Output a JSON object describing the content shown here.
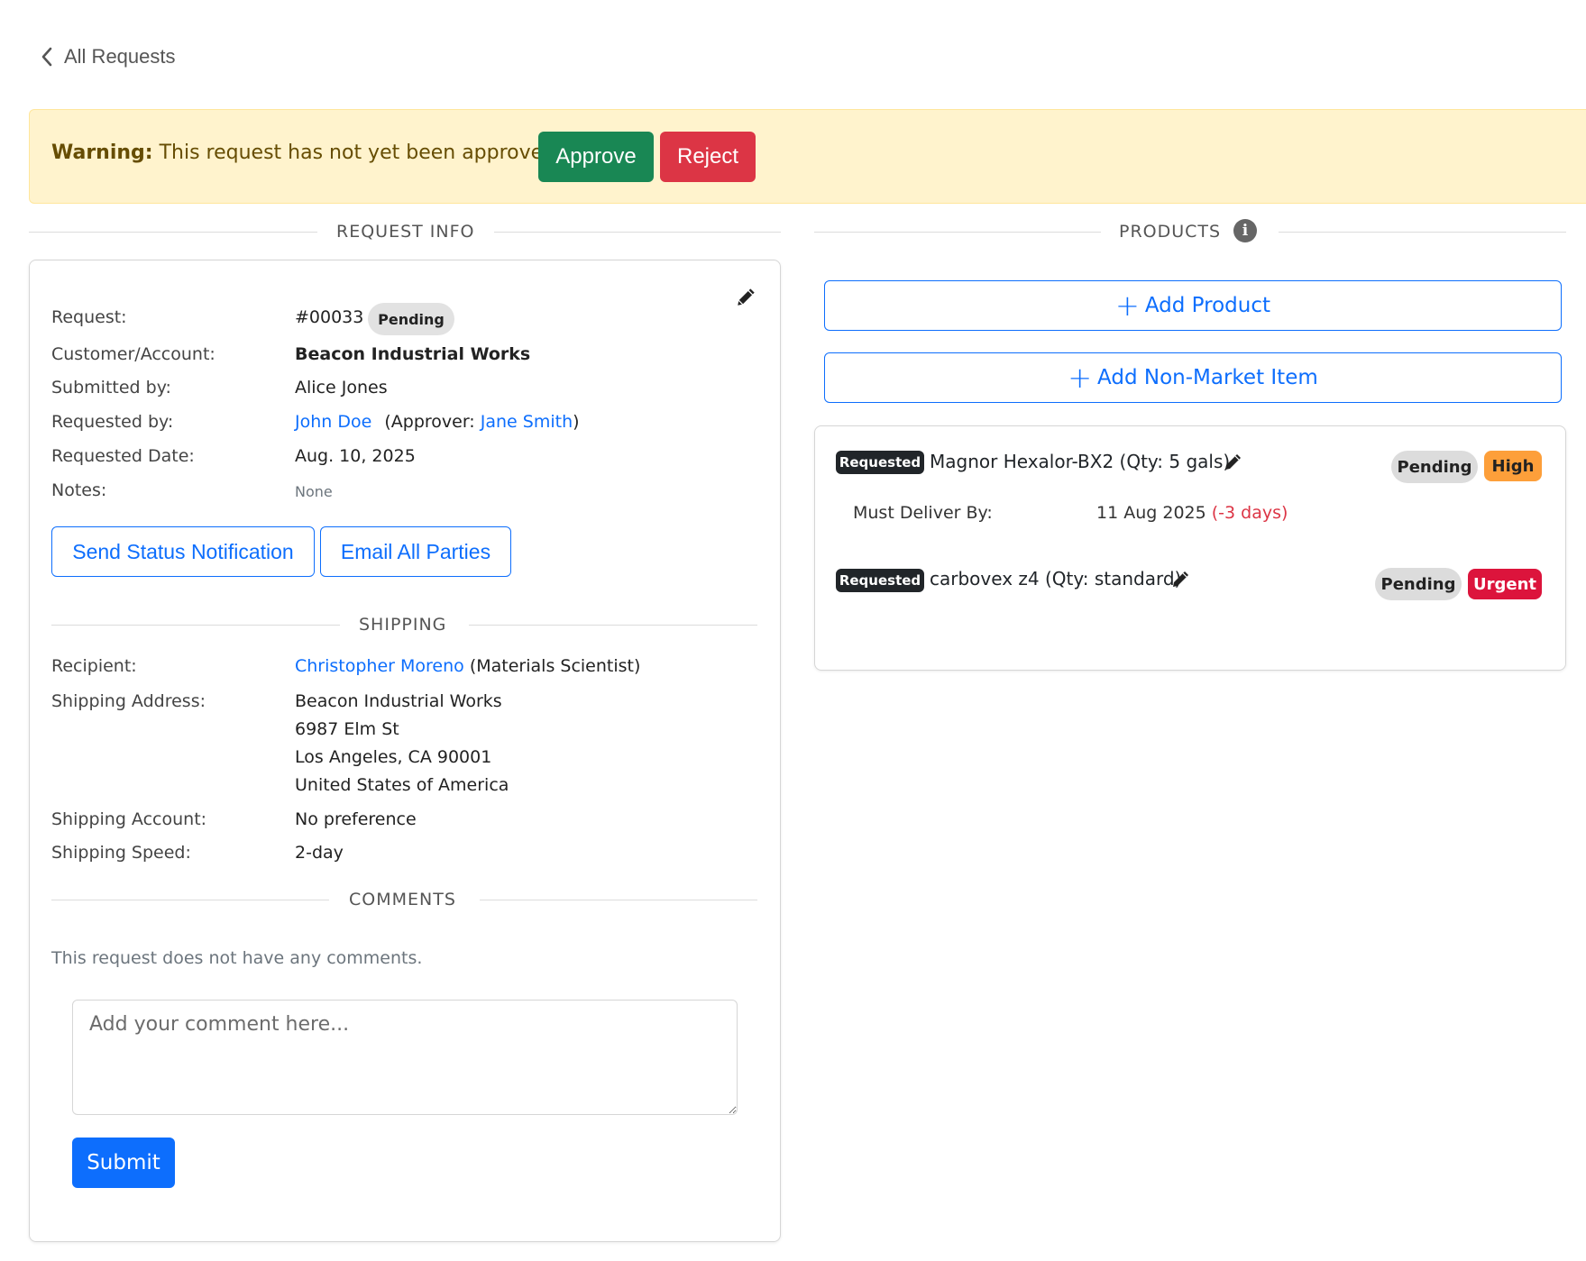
{
  "nav": {
    "back_label": "All Requests"
  },
  "warning": {
    "prefix": "Warning:",
    "message": " This request has not yet been approved.",
    "approve_label": "Approve",
    "reject_label": "Reject"
  },
  "request_info": {
    "section_title": "REQUEST INFO",
    "rows": {
      "request_label": "Request:",
      "request_id": "#00033",
      "status": "Pending",
      "customer_label": "Customer/Account:",
      "customer_value": "Beacon Industrial Works",
      "submitted_label": "Submitted by:",
      "submitted_value": "Alice Jones",
      "requested_by_label": "Requested by:",
      "requested_by_value": "John Doe",
      "approver_prefix": "(Approver:",
      "approver_value": "Jane Smith",
      "approver_suffix": ")",
      "requested_date_label": "Requested Date:",
      "requested_date_value": "Aug. 10, 2025",
      "notes_label": "Notes:",
      "notes_value": "None"
    },
    "send_status_label": "Send Status Notification",
    "email_all_label": "Email All Parties"
  },
  "shipping": {
    "section_title": "SHIPPING",
    "recipient_label": "Recipient:",
    "recipient_name": "Christopher Moreno",
    "recipient_role": "(Materials Scientist)",
    "address_label": "Shipping Address:",
    "address_lines": [
      "Beacon Industrial Works",
      "6987 Elm St",
      "Los Angeles, CA 90001",
      "United States of America"
    ],
    "account_label": "Shipping Account:",
    "account_value": "No preference",
    "speed_label": "Shipping Speed:",
    "speed_value": "2-day"
  },
  "comments": {
    "section_title": "COMMENTS",
    "empty_text": "This request does not have any comments.",
    "placeholder": "Add your comment here...",
    "submit_label": "Submit"
  },
  "products": {
    "section_title": "PRODUCTS",
    "add_product_label": "Add Product",
    "add_non_market_label": "Add Non-Market Item",
    "items": [
      {
        "tag": "Requested",
        "name": "Magnor Hexalor-BX2 (Qty: 5 gals)",
        "status": "Pending",
        "priority": "High",
        "deliver_label": "Must Deliver By:",
        "deliver_date": "11 Aug 2025",
        "deliver_offset": "(-3 days)"
      },
      {
        "tag": "Requested",
        "name": "carbovex z4 (Qty: standard)",
        "status": "Pending",
        "priority": "Urgent"
      }
    ]
  },
  "colors": {
    "primary": "#0d6efd",
    "success": "#198754",
    "danger": "#dc3545",
    "warning_bg": "#fff3cd",
    "high": "#fd9f3a",
    "urgent": "#dc143c"
  }
}
